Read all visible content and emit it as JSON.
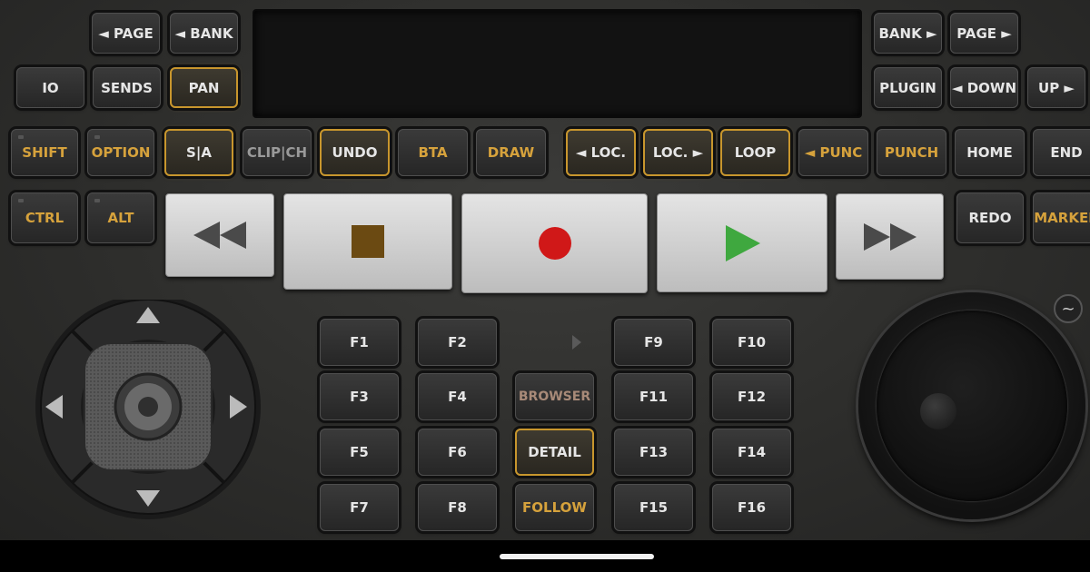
{
  "top_left": {
    "page_prev": "◄ PAGE",
    "bank_prev": "◄ BANK"
  },
  "top_right": {
    "bank_next": "BANK ►",
    "page_next": "PAGE ►"
  },
  "row2_left": {
    "io": "IO",
    "sends": "SENDS",
    "pan": "PAN"
  },
  "row2_right": {
    "plugin": "PLUGIN",
    "down": "◄ DOWN",
    "up": "UP ►"
  },
  "row3": {
    "shift": "SHIFT",
    "option": "OPTION",
    "sa": "S|A",
    "clipch": "CLIP|CH",
    "undo": "UNDO",
    "bta": "BTA",
    "draw": "DRAW",
    "loc_prev": "◄ LOC.",
    "loc_next": "LOC. ►",
    "loop": "LOOP",
    "punc_prev": "◄ PUNC",
    "punch": "PUNCH",
    "home": "HOME",
    "end": "END"
  },
  "row4": {
    "ctrl": "CTRL",
    "alt": "ALT",
    "redo": "REDO",
    "marker": "MARKER"
  },
  "fkeys": {
    "f1": "F1",
    "f2": "F2",
    "f3": "F3",
    "f4": "F4",
    "f5": "F5",
    "f6": "F6",
    "f7": "F7",
    "f8": "F8",
    "f9": "F9",
    "f10": "F10",
    "f11": "F11",
    "f12": "F12",
    "f13": "F13",
    "f14": "F14",
    "f15": "F15",
    "f16": "F16"
  },
  "mid_keys": {
    "browser": "BROWSER",
    "detail": "DETAIL",
    "follow": "FOLLOW"
  },
  "jog": {
    "mode_symbol": "~"
  },
  "colors": {
    "accent_amber": "#c8962d",
    "record_red": "#d01818",
    "play_green": "#3fa83f",
    "stop_brown": "#6b4a12"
  }
}
